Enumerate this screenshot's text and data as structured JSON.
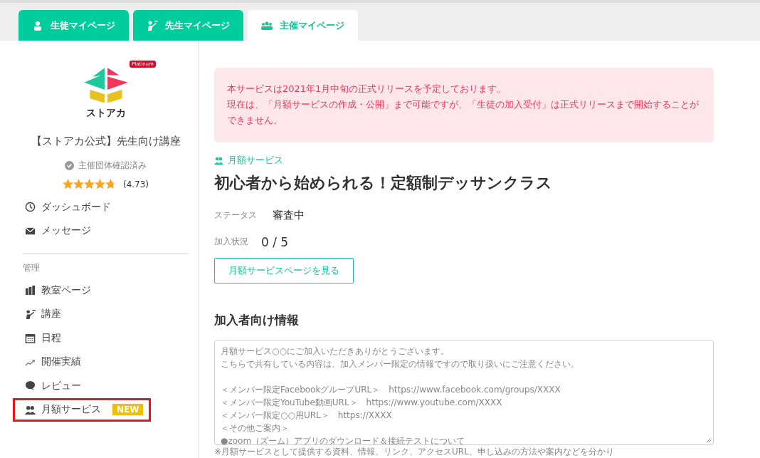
{
  "tabs": [
    {
      "label": "生徒マイページ",
      "kind": "student",
      "selected": false
    },
    {
      "label": "先生マイページ",
      "kind": "teacher",
      "selected": false
    },
    {
      "label": "主催マイページ",
      "kind": "group",
      "selected": true
    }
  ],
  "sidebar": {
    "org_name": "【ストアカ公式】先生向け講座",
    "logo_text": "ストアカ",
    "badge_text": "Platinum",
    "verified": "主催団体確認済み",
    "stars": 4.73,
    "rating": "(4.73)",
    "top_items": [
      {
        "label": "ダッシュボード",
        "kind": "dashboard",
        "highlighted": false
      },
      {
        "label": "メッセージ",
        "kind": "mail",
        "highlighted": false
      }
    ],
    "section_label": "管理",
    "items": [
      {
        "label": "教室ページ",
        "kind": "building",
        "highlighted": false
      },
      {
        "label": "講座",
        "kind": "teacher",
        "highlighted": false
      },
      {
        "label": "日程",
        "kind": "calendar",
        "highlighted": false
      },
      {
        "label": "開催実績",
        "kind": "trend",
        "highlighted": false
      },
      {
        "label": "レビュー",
        "kind": "bubble",
        "highlighted": false
      },
      {
        "label": "月額サービス",
        "kind": "group",
        "badge": "NEW",
        "highlighted": true
      }
    ]
  },
  "alert": {
    "lines": [
      "本サービスは2021年1月中旬の正式リリースを予定しております。",
      "現在は、「月額サービスの作成・公開」まで可能ですが、「生徒の加入受付」は正式リリースまで開始することができません。"
    ]
  },
  "service": {
    "category": "月額サービス",
    "title": "初心者から始められる！定額制デッサンクラス",
    "fields": [
      {
        "label": "ステータス",
        "value": "審査中"
      },
      {
        "label": "加入状況",
        "value": "0 / 5"
      }
    ],
    "button": "月額サービスページを見る"
  },
  "member_info": {
    "heading": "加入者向け情報",
    "paragraphs": [
      [
        "月額サービス○○にご加入いただきありがとうございます。",
        "こちらで共有している内容は、加入メンバー限定の情報ですので取り扱いにご注意ください。"
      ],
      [
        "＜メンバー限定FacebookグループURL＞　https://www.facebook.com/groups/XXXX",
        "＜メンバー限定YouTube動画URL＞　https://www.youtube.com/XXXX",
        "＜メンバー限定○○用URL＞　https://XXXX",
        "＜その他ご案内＞",
        "●zoom（ズーム）アプリのダウンロード＆接続テストについて"
      ]
    ],
    "note": "※月額サービスとして提供する資料、情報、リンク、アクセスURL、申し込みの方法や案内などを分かり"
  }
}
